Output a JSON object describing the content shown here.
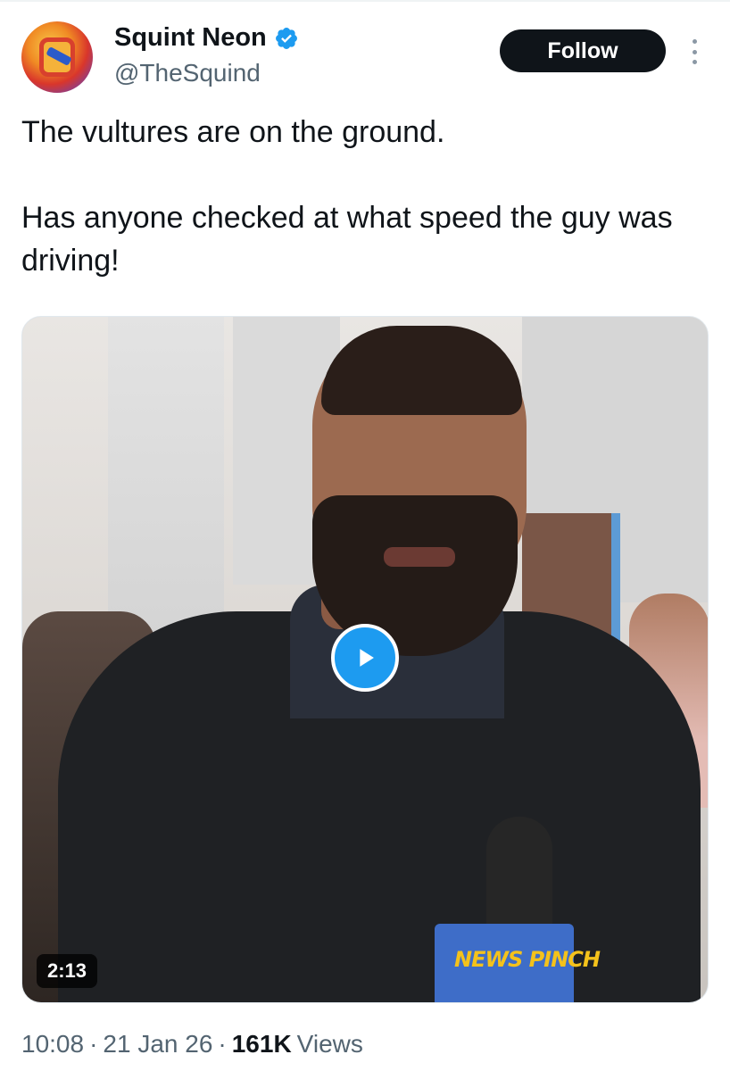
{
  "author": {
    "display_name": "Squint Neon",
    "handle": "@TheSquind",
    "verified": true,
    "avatar_icon": "squint-neon-logo"
  },
  "actions": {
    "follow_label": "Follow",
    "more_icon": "more-vertical-icon"
  },
  "tweet": {
    "paragraphs": [
      "The vultures are on the ground.",
      "Has anyone checked at what speed the guy was driving!"
    ]
  },
  "media": {
    "type": "video",
    "duration": "2:13",
    "mic_flag_text": "NEWS PINCH"
  },
  "meta": {
    "time": "10:08",
    "separator": "·",
    "date": "21 Jan 26",
    "views_count": "161K",
    "views_label": "Views"
  },
  "colors": {
    "accent": "#1d9bf0",
    "text_primary": "#0f1419",
    "text_secondary": "#536471",
    "follow_bg": "#0f1419"
  }
}
